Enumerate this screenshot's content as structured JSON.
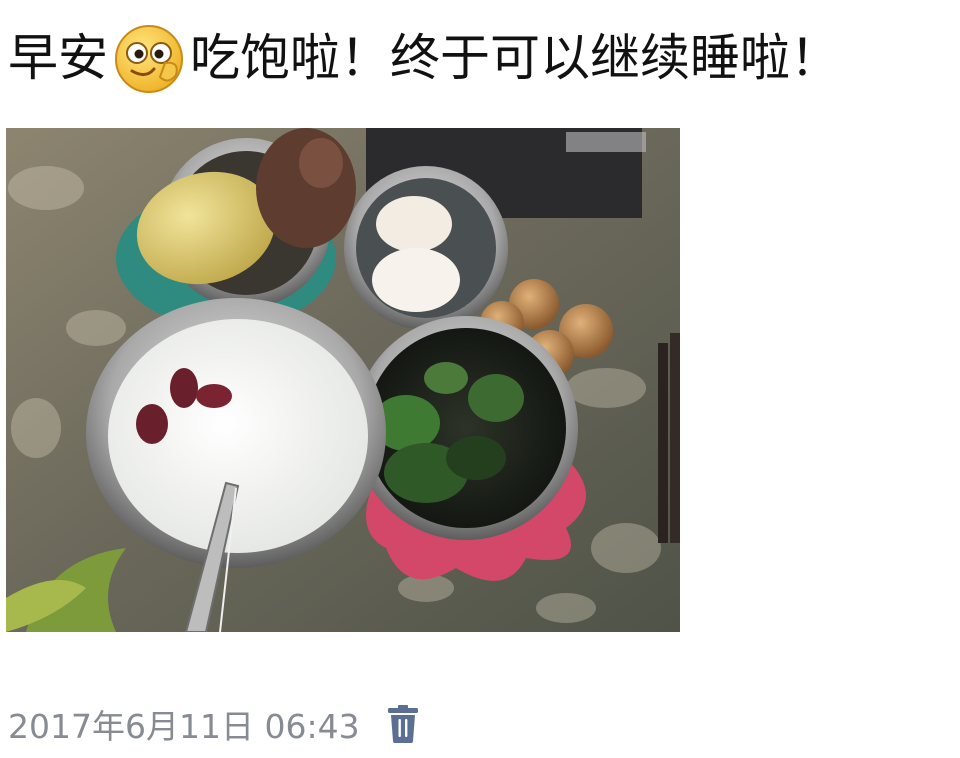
{
  "post": {
    "text_before_emoji": "早安",
    "emoji": "silly-face-emoji",
    "text_after_emoji": "吃饱啦！终于可以继续睡啦！"
  },
  "photo": {
    "alt": "breakfast-photo"
  },
  "meta": {
    "timestamp": "2017年6月11日  06:43",
    "delete_icon": "trash-icon"
  },
  "colors": {
    "text": "#111111",
    "meta_text": "#878b93",
    "delete_icon": "#5b6f95"
  }
}
